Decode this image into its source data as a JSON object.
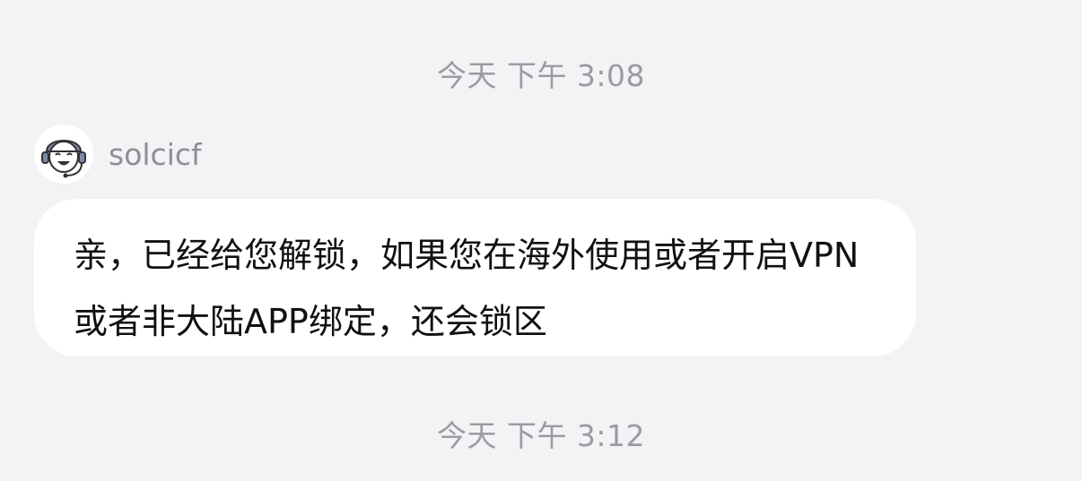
{
  "chat": {
    "timestamps": [
      "今天 下午 3:08",
      "今天 下午 3:12"
    ],
    "sender": {
      "name": "solcicf",
      "avatar_icon": "customer-service-agent-icon"
    },
    "message": {
      "text": "亲，已经给您解锁，如果您在海外使用或者开启VPN或者非大陆APP绑定，还会锁区"
    }
  }
}
